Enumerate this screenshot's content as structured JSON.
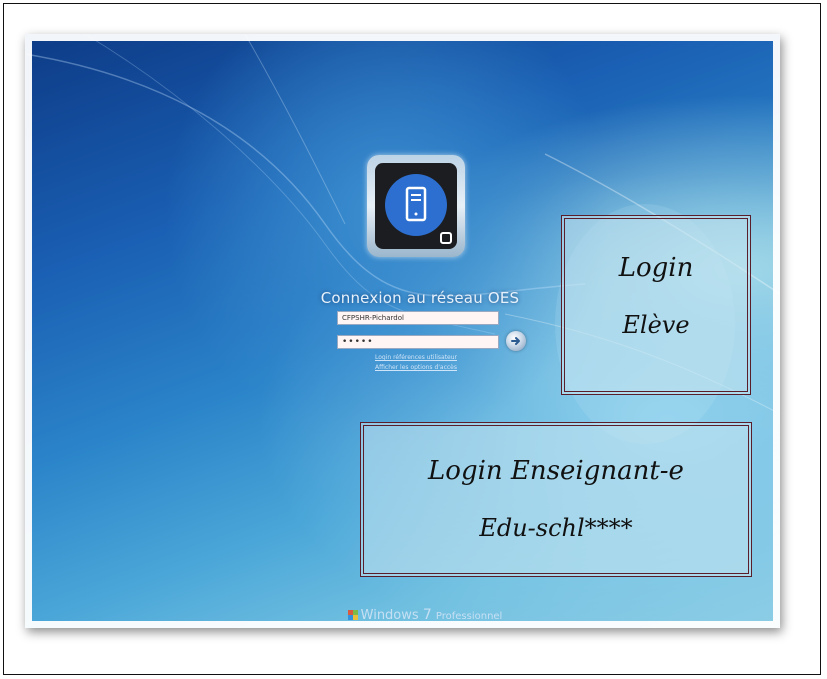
{
  "login_screen": {
    "title": "Connexion au réseau OES",
    "username_value": "CFPSHR-Pichardol",
    "password_value": "•••••",
    "link_switch_user": "Login références utilisateur",
    "link_options": "Afficher les options d'accès",
    "brand": {
      "name": "Windows",
      "version": "7",
      "edition": "Professionnel"
    }
  },
  "annotations": {
    "student": {
      "line1": "Login",
      "line2": "Elève"
    },
    "teacher": {
      "line1": "Login Enseignant-e",
      "line2": "Edu-schl****"
    }
  },
  "colors": {
    "annotation_border": "#5a1e2a",
    "tile_circle": "#2c6fd0",
    "background_top": "#0d3b86",
    "background_bottom": "#8dcde4"
  },
  "icons": {
    "user_tile": "server-tower-icon",
    "submit": "arrow-right-circle-icon",
    "logo": "windows-flag-icon"
  }
}
